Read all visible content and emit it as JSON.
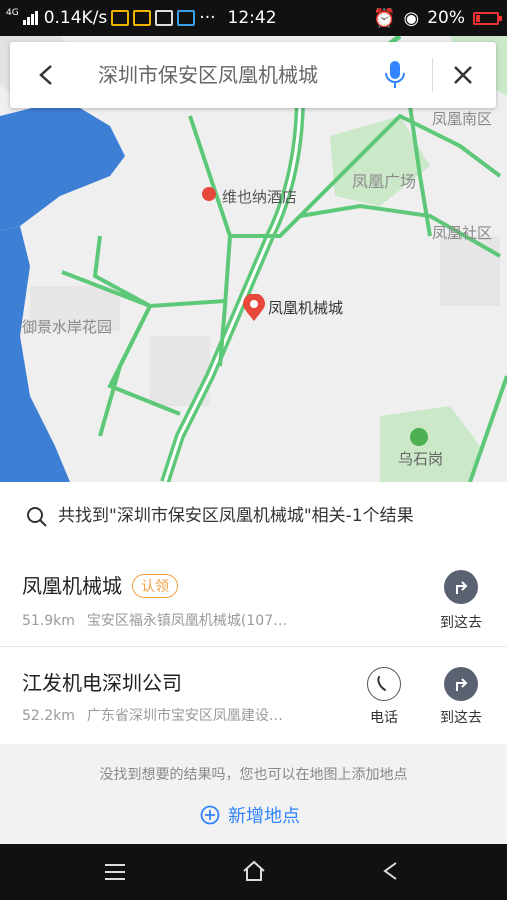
{
  "status_bar": {
    "network_type": "4G",
    "speed": "0.14K/s",
    "overflow": "···",
    "time": "12:42",
    "battery": "20%"
  },
  "map": {
    "labels": {
      "hotel": "维也纳酒店",
      "fenghuang_nanqu": "凤凰南区",
      "fenghuang_guangchang": "凤凰广场",
      "fenghuang_shequ": "凤凰社区",
      "marker": "凤凰机械城",
      "yujing": "御景水岸花园",
      "wushigang": "乌石岗"
    },
    "colors": {
      "water": "#3e7fd6",
      "road": "#5cc878",
      "green": "#cbe8c9",
      "marker": "#e8483b"
    }
  },
  "search": {
    "query": "深圳市保安区凤凰机械城"
  },
  "summary": {
    "text": "共找到\"深圳市保安区凤凰机械城\"相关-1个结果"
  },
  "results": [
    {
      "name": "凤凰机械城",
      "tag": "认领",
      "distance": "51.9km",
      "address": "宝安区福永镇凤凰机械城(107…",
      "route_label": "到这去"
    },
    {
      "name": "江发机电深圳公司",
      "distance": "52.2km",
      "address": "广东省深圳市宝安区凤凰建设…",
      "call_label": "电话",
      "route_label": "到这去"
    }
  ],
  "footer": {
    "hint": "没找到想要的结果吗，您也可以在地图上添加地点",
    "add_label": "新增地点"
  }
}
